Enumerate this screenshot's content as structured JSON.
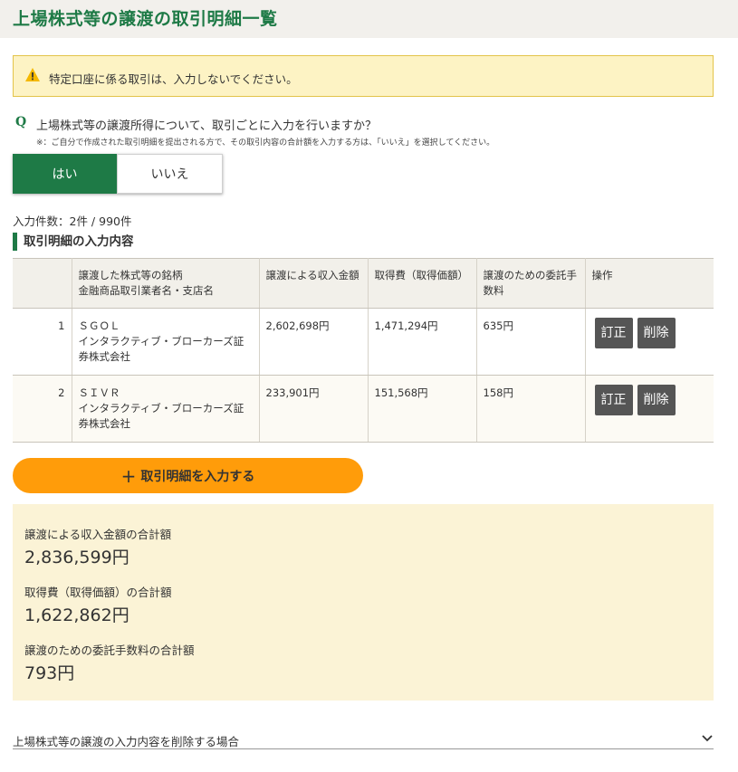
{
  "page": {
    "title": "上場株式等の譲渡の取引明細一覧"
  },
  "warning": {
    "icon": "warning-icon",
    "icon_color": "#f5b800",
    "message": "特定口座に係る取引は、入力しないでください。"
  },
  "question": {
    "mark": "Q",
    "text": "上場株式等の譲渡所得について、取引ごとに入力を行いますか？",
    "note": "※：ご自分で作成された取引明細を提出される方で、その取引内容の合計額を入力する方は、「いいえ」を選択してください。",
    "yes_label": "はい",
    "no_label": "いいえ",
    "selected": "はい"
  },
  "count_text": "入力件数：2件 / 990件",
  "section_title": "取引明細の入力内容",
  "table": {
    "headers": [
      "",
      "譲渡した株式等の銘柄\n金融商品取引業者名・支店名",
      "譲渡による収入金額",
      "取得費（取得価額）",
      "譲渡のための委託手数料",
      "操作"
    ],
    "rows": [
      {
        "no": "1",
        "name": "ＳＧＯＬ\nインタラクティブ・ブローカーズ証券株式会社",
        "income": "2,602,698円",
        "cost": "1,471,294円",
        "fee": "635円",
        "edit_label": "訂正",
        "delete_label": "削除"
      },
      {
        "no": "2",
        "name": "ＳＩＶＲ\nインタラクティブ・ブローカーズ証券株式会社",
        "income": "233,901円",
        "cost": "151,568円",
        "fee": "158円",
        "edit_label": "訂正",
        "delete_label": "削除"
      }
    ]
  },
  "add_button": {
    "icon": "plus-icon",
    "label": "取引明細を入力する"
  },
  "totals": {
    "income_label": "譲渡による収入金額の合計額",
    "income_value": "2,836,599円",
    "cost_label": "取得費（取得価額）の合計額",
    "cost_value": "1,622,862円",
    "fee_label": "譲渡のための委託手数料の合計額",
    "fee_value": "793円"
  },
  "collapse": {
    "label": "上場株式等の譲渡の入力内容を削除する場合",
    "icon": "chevron-down-icon"
  },
  "colors": {
    "brand_green": "#1e7a46",
    "accent_orange": "#ff9c0a",
    "warning_bg": "#fdf3c4",
    "totals_bg": "#fbf3d6"
  }
}
